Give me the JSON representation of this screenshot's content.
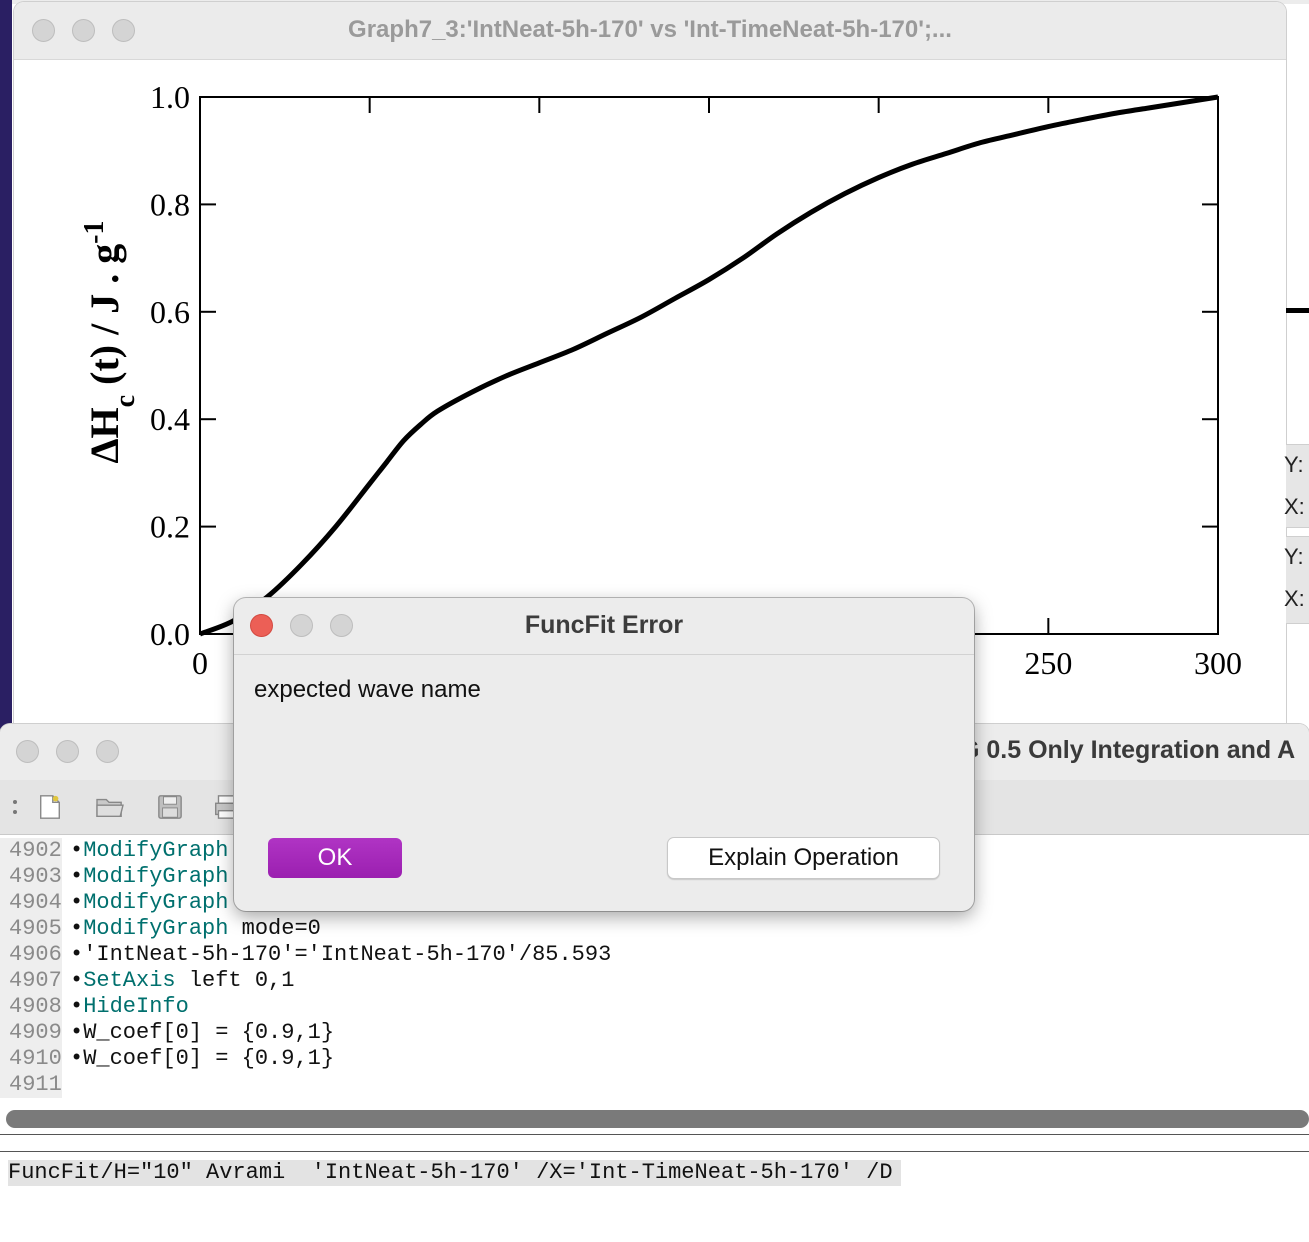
{
  "graph_window": {
    "title": "Graph7_3:'IntNeat-5h-170' vs 'Int-TimeNeat-5h-170';...",
    "right_edge_labels": [
      "Y:",
      "X:",
      "Y:",
      "X:"
    ]
  },
  "chart_data": {
    "type": "line",
    "ylabel": "ΔHc (t) / J . g-1",
    "ylabel_parts": {
      "main": "ΔH",
      "sub": "c",
      "mid": " (t) / J . g",
      "sup": "-1"
    },
    "xlim": [
      0,
      300
    ],
    "ylim": [
      0,
      1.0
    ],
    "x_ticks": [
      "0",
      "50",
      "100",
      "150",
      "200",
      "250",
      "300"
    ],
    "x_tick_values": [
      0,
      50,
      100,
      150,
      200,
      250,
      300
    ],
    "y_ticks": [
      "0.0",
      "0.2",
      "0.4",
      "0.6",
      "0.8",
      "1.0"
    ],
    "y_tick_values": [
      0,
      0.2,
      0.4,
      0.6,
      0.8,
      1.0
    ],
    "grid": false,
    "series": [
      {
        "x": [
          0,
          10,
          20,
          30,
          40,
          50,
          55,
          60,
          65,
          70,
          80,
          90,
          100,
          110,
          120,
          130,
          140,
          150,
          160,
          170,
          180,
          190,
          200,
          210,
          220,
          230,
          240,
          250,
          260,
          270,
          280,
          290,
          300
        ],
        "y": [
          0,
          0.025,
          0.07,
          0.13,
          0.2,
          0.28,
          0.32,
          0.36,
          0.39,
          0.415,
          0.45,
          0.48,
          0.505,
          0.53,
          0.56,
          0.59,
          0.625,
          0.66,
          0.7,
          0.745,
          0.785,
          0.82,
          0.85,
          0.875,
          0.895,
          0.915,
          0.93,
          0.945,
          0.958,
          0.97,
          0.98,
          0.99,
          1.0
        ]
      }
    ]
  },
  "history_window": {
    "title": "G 0.5 Only Integration and A",
    "lines": [
      {
        "num": "4902",
        "kw": "ModifyGraph",
        "rest": ""
      },
      {
        "num": "4903",
        "kw": "ModifyGraph",
        "rest": ""
      },
      {
        "num": "4904",
        "kw": "ModifyGraph",
        "rest": ""
      },
      {
        "num": "4905",
        "kw": "ModifyGraph",
        "rest": " mode=0"
      },
      {
        "num": "4906",
        "kw": "",
        "rest": "'IntNeat-5h-170'='IntNeat-5h-170'/85.593"
      },
      {
        "num": "4907",
        "kw": "SetAxis",
        "rest": " left 0,1"
      },
      {
        "num": "4908",
        "kw": "HideInfo",
        "rest": ""
      },
      {
        "num": "4909",
        "kw": "",
        "rest": "W_coef[0] = {0.9,1}"
      },
      {
        "num": "4910",
        "kw": "",
        "rest": "W_coef[0] = {0.9,1}"
      },
      {
        "num": "4911",
        "kw": "",
        "rest": ""
      }
    ],
    "bullet": "•",
    "command_line": "FuncFit/H=\"10\" Avrami  'IntNeat-5h-170' /X='Int-TimeNeat-5h-170' /D"
  },
  "dialog": {
    "title": "FuncFit Error",
    "message": "expected wave name",
    "ok_label": "OK",
    "explain_label": "Explain Operation",
    "accent": "#a528b9"
  }
}
